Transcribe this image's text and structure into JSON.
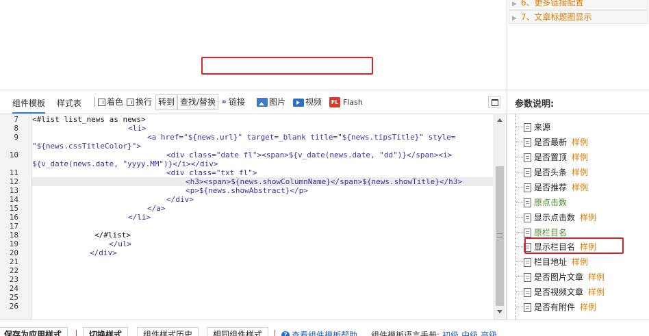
{
  "right_top_items": [
    {
      "arrow": "▶",
      "label": "6、更多链接配置"
    },
    {
      "arrow": "▶",
      "label": "7、文章标题图显示"
    }
  ],
  "tabs": {
    "template": "组件模板",
    "style": "样式表"
  },
  "toolbar": {
    "color_label": "着色",
    "wrap_label": "换行",
    "goto_label": "转到",
    "find_replace_label": "查找/替换",
    "link_label": "链接",
    "image_label": "图片",
    "video_label": "视频",
    "flash_label": "Flash",
    "flash_icon": "FL"
  },
  "params": {
    "title": "参数说明:",
    "items": [
      {
        "name": "来源",
        "example": "",
        "green": false
      },
      {
        "name": "是否最新",
        "example": "样例",
        "green": false
      },
      {
        "name": "是否置顶",
        "example": "样例",
        "green": false
      },
      {
        "name": "是否头条",
        "example": "样例",
        "green": false
      },
      {
        "name": "是否推荐",
        "example": "样例",
        "green": false
      },
      {
        "name": "原点击数",
        "example": "",
        "green": true
      },
      {
        "name": "显示点击数",
        "example": "样例",
        "green": false
      },
      {
        "name": "原栏目名",
        "example": "",
        "green": true
      },
      {
        "name": "显示栏目名",
        "example": "样例",
        "green": false
      },
      {
        "name": "栏目地址",
        "example": "样例",
        "green": false
      },
      {
        "name": "是否图片文章",
        "example": "样例",
        "green": false
      },
      {
        "name": "是否视频文章",
        "example": "样例",
        "green": false
      },
      {
        "name": "是否有附件",
        "example": "样例",
        "green": false
      }
    ]
  },
  "editor": {
    "line_numbers": [
      "7",
      "8",
      "9",
      "",
      "10",
      "",
      "11",
      "12",
      "13",
      "14",
      "15",
      "16",
      "17",
      "18",
      "19",
      "20",
      "21",
      "22",
      "23",
      "24",
      "25",
      "26"
    ],
    "lines": {
      "l7": "<#list list_news as news>",
      "l8": "<li>",
      "l9a": "<a href=\"${news.url}\" target=_blank title=\"${news.tipsTitle}\" style=",
      "l9b": "\"${news.cssTitleColor}\">",
      "l10a": "<div class=\"date fl\"><span>${v_date(news.date, \"dd\")}</span><i>",
      "l10b": "${v_date(news.date, \"yyyy.MM\")}</i></div>",
      "l11": "<div class=\"txt fl\">",
      "l12": "<h3><span>${news.showColumnName}</span>${news.showTitle}</h3>",
      "l13": "<p>${news.showAbstract}</p>",
      "l14": "</div>",
      "l15": "</a>",
      "l16": "</li>",
      "l18": "</#list>",
      "l19": "</ul>",
      "l20": "</div>"
    }
  },
  "bottom": {
    "save_recent": "保存为应用样式",
    "switch_style": "切换样式",
    "component_history": "组件样式历史",
    "same_component": "相同组件样式",
    "help_icon": "?",
    "help_link": "查看组件模板帮助",
    "manual_label": "组件模板语言手册:",
    "manual_beginner": "初级",
    "manual_mid": "中级",
    "manual_adv": "高级"
  },
  "colors": {
    "accent": "#2a7de1",
    "highlight_border": "#e02020",
    "example": "#e07b00"
  }
}
